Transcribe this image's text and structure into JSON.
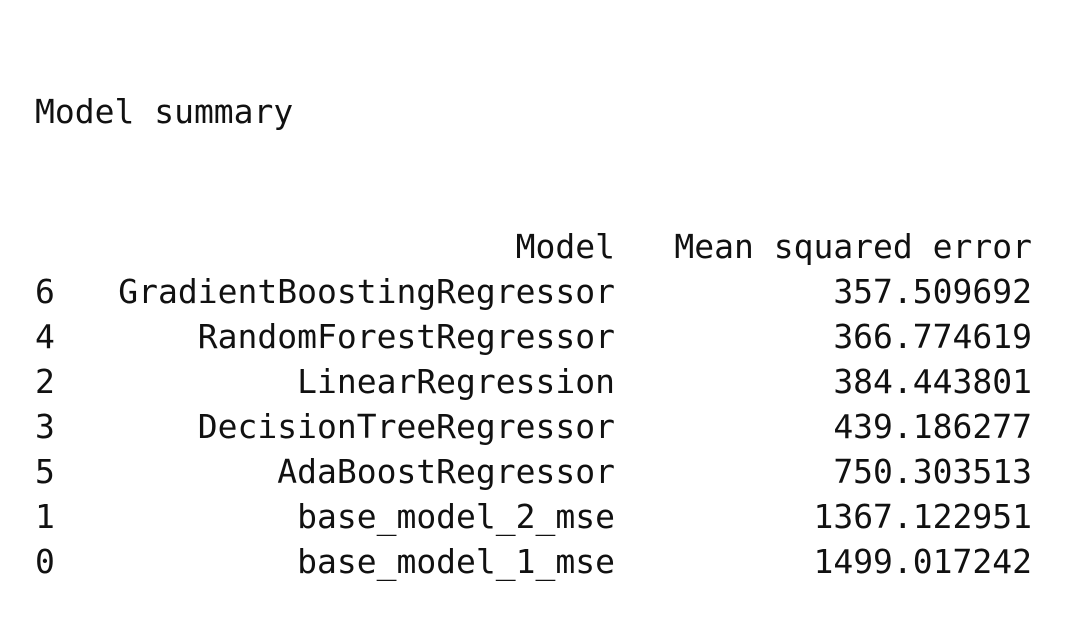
{
  "output": {
    "title": "Model summary",
    "columns": {
      "index": "",
      "model": "Model",
      "mse": "Mean squared error"
    },
    "rows": [
      {
        "index": "6",
        "model": "GradientBoostingRegressor",
        "mse": "357.509692"
      },
      {
        "index": "4",
        "model": "RandomForestRegressor",
        "mse": "366.774619"
      },
      {
        "index": "2",
        "model": "LinearRegression",
        "mse": "384.443801"
      },
      {
        "index": "3",
        "model": "DecisionTreeRegressor",
        "mse": "439.186277"
      },
      {
        "index": "5",
        "model": "AdaBoostRegressor",
        "mse": "750.303513"
      },
      {
        "index": "1",
        "model": "base_model_2_mse",
        "mse": "1367.122951"
      },
      {
        "index": "0",
        "model": "base_model_1_mse",
        "mse": "1499.017242"
      }
    ]
  }
}
